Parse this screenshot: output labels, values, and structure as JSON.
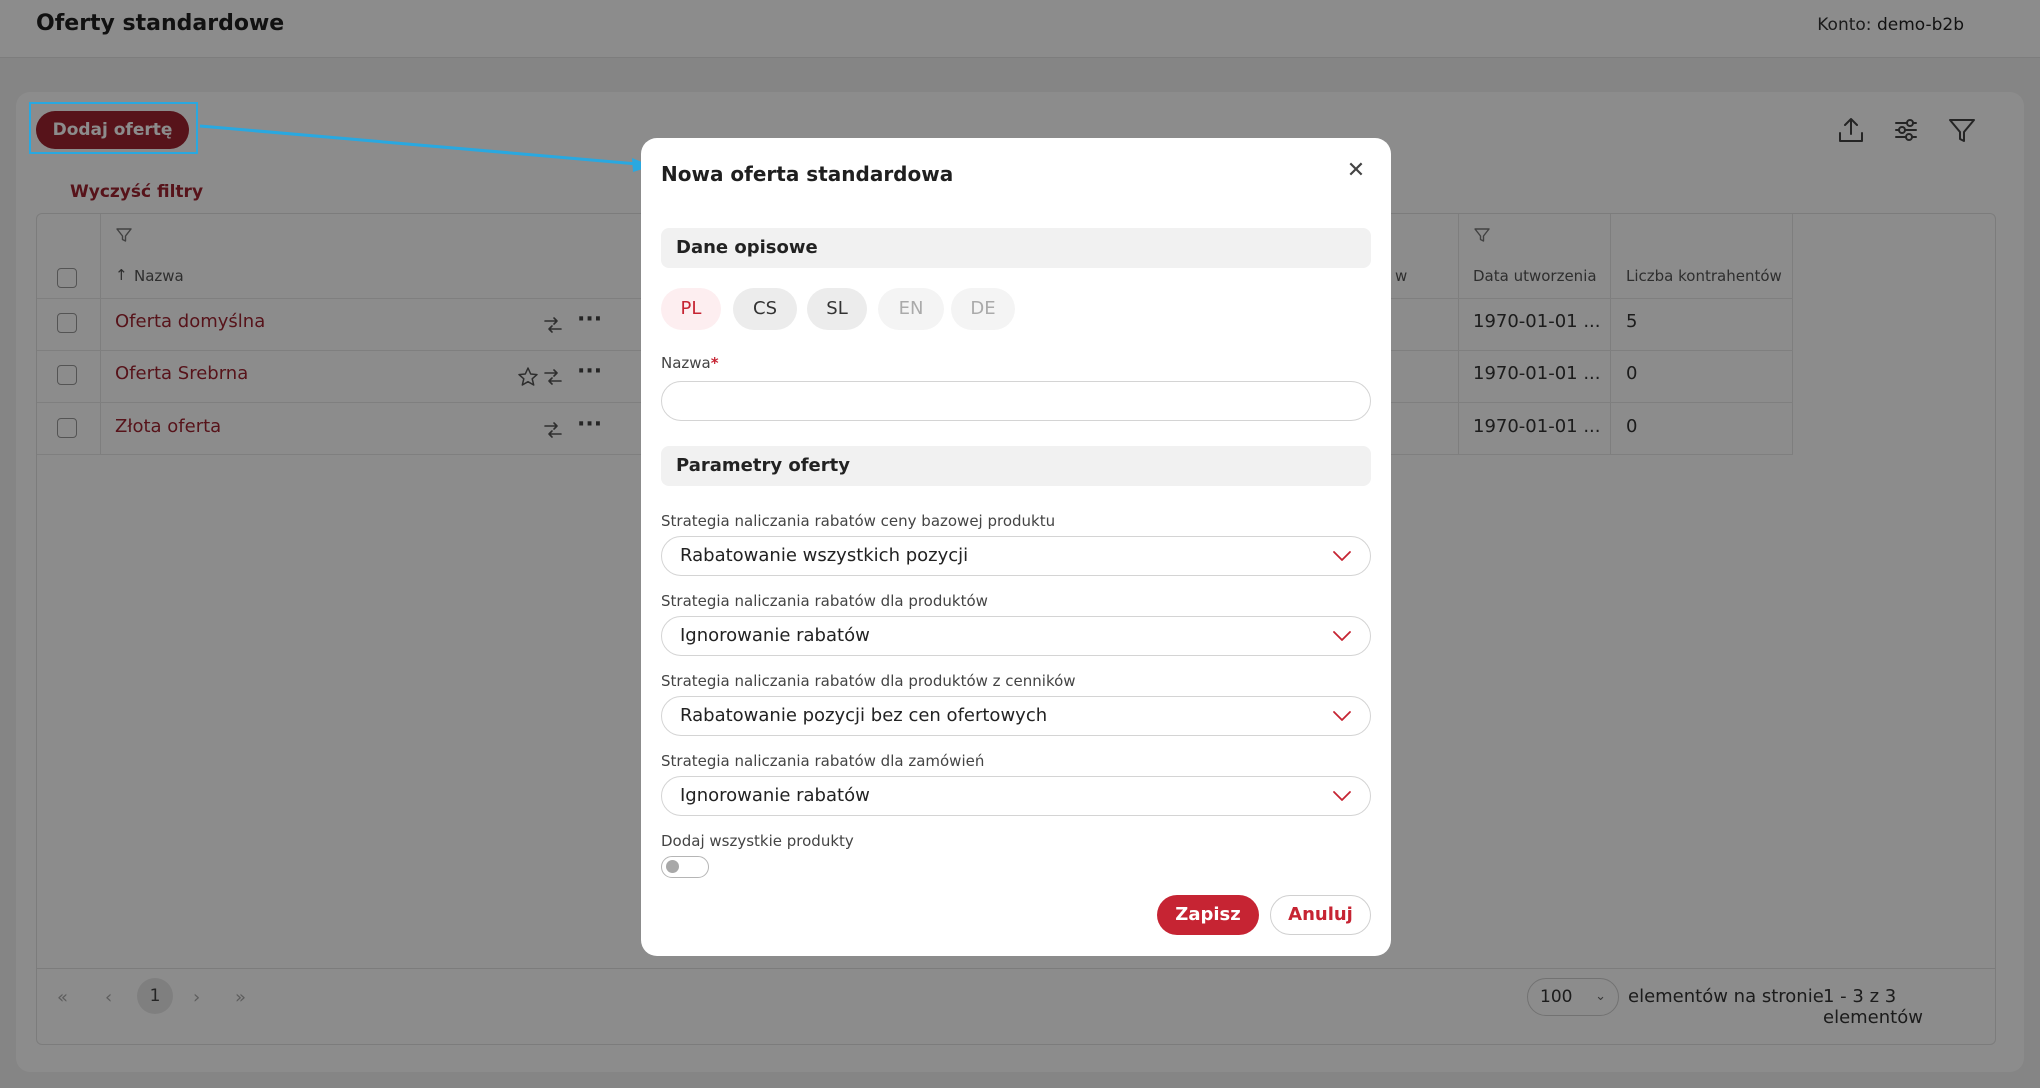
{
  "header": {
    "page_title": "Oferty standardowe",
    "account_label": "Konto:",
    "account_value": "demo-b2b"
  },
  "toolbar": {
    "add_offer_label": "Dodaj ofertę",
    "clear_filters_label": "Wyczyść filtry",
    "icons": [
      "export-icon",
      "settings-sliders-icon",
      "filter-icon"
    ]
  },
  "table": {
    "columns": [
      "Nazwa",
      "Data utworzenia",
      "Liczba kontrahentów"
    ],
    "hidden_column_tail": "w",
    "rows": [
      {
        "name": "Oferta domyślna",
        "date": "1970-01-01 ...",
        "count": "5"
      },
      {
        "name": "Oferta Srebrna",
        "date": "1970-01-01 ...",
        "count": "0"
      },
      {
        "name": "Złota oferta",
        "date": "1970-01-01 ...",
        "count": "0"
      }
    ]
  },
  "pagination": {
    "current_page": "1",
    "page_size": "100",
    "per_page_label": "elementów na stronie",
    "range_label": "1 - 3 z 3 elementów"
  },
  "modal": {
    "title": "Nowa oferta standardowa",
    "section_descriptive": "Dane opisowe",
    "languages": [
      {
        "code": "PL",
        "state": "active"
      },
      {
        "code": "CS",
        "state": "normal"
      },
      {
        "code": "SL",
        "state": "normal"
      },
      {
        "code": "EN",
        "state": "disabled"
      },
      {
        "code": "DE",
        "state": "disabled"
      }
    ],
    "name_label": "Nazwa",
    "name_required_mark": "*",
    "name_value": "",
    "section_params": "Parametry oferty",
    "strategies": [
      {
        "label": "Strategia naliczania rabatów ceny bazowej produktu",
        "value": "Rabatowanie wszystkich pozycji"
      },
      {
        "label": "Strategia naliczania rabatów dla produktów",
        "value": "Ignorowanie rabatów"
      },
      {
        "label": "Strategia naliczania rabatów dla produktów z cenników",
        "value": "Rabatowanie pozycji bez cen ofertowych"
      },
      {
        "label": "Strategia naliczania rabatów dla zamówień",
        "value": "Ignorowanie rabatów"
      }
    ],
    "add_all_products_label": "Dodaj wszystkie produkty",
    "add_all_products_enabled": false,
    "save_label": "Zapisz",
    "cancel_label": "Anuluj"
  },
  "colors": {
    "brand": "#c62433",
    "brand_dark": "#9e2431",
    "annotation": "#29a8e0"
  }
}
